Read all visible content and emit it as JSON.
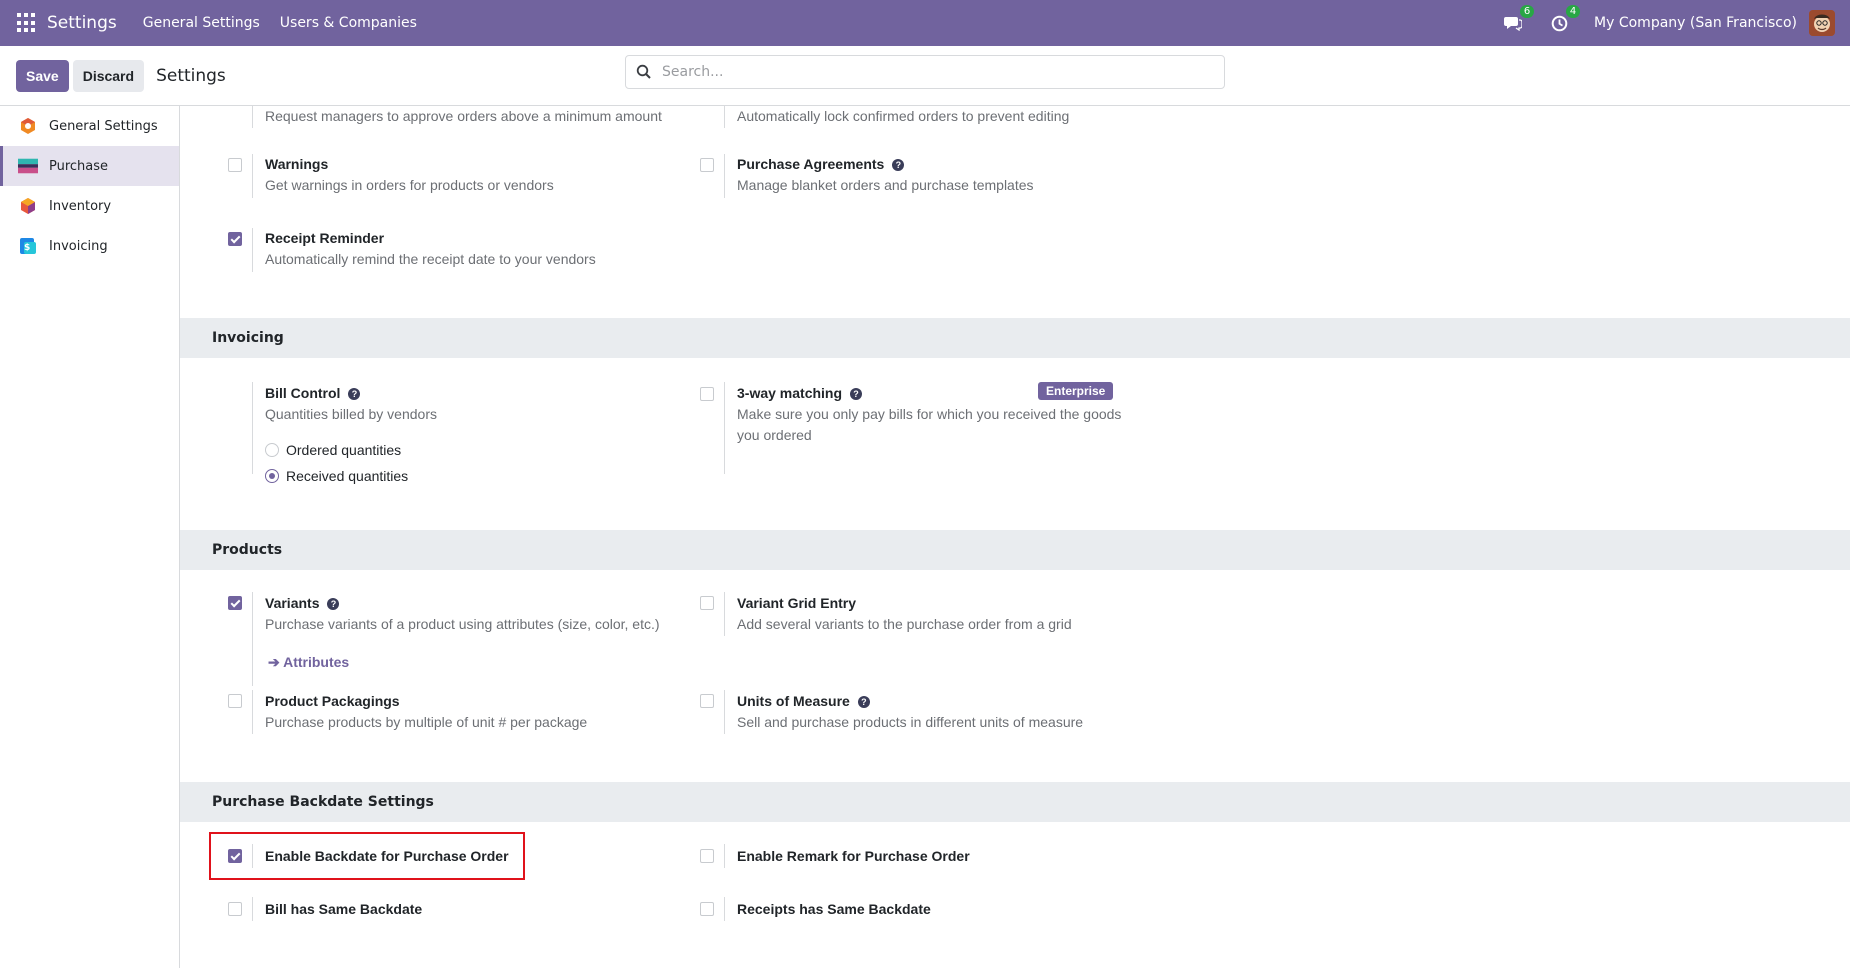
{
  "topbar": {
    "app_title": "Settings",
    "menu_items": [
      "General Settings",
      "Users & Companies"
    ],
    "messages_count": "6",
    "activities_count": "4",
    "company": "My Company (San Francisco)"
  },
  "control": {
    "save_label": "Save",
    "discard_label": "Discard",
    "title": "Settings",
    "search_placeholder": "Search..."
  },
  "sidebar": {
    "items": [
      {
        "label": "General Settings",
        "icon": "general-settings-icon",
        "active": false
      },
      {
        "label": "Purchase",
        "icon": "purchase-icon",
        "active": true
      },
      {
        "label": "Inventory",
        "icon": "inventory-icon",
        "active": false
      },
      {
        "label": "Invoicing",
        "icon": "invoicing-icon",
        "active": false
      }
    ]
  },
  "orders_partial": {
    "left_desc": "Request managers to approve orders above a minimum amount",
    "right_desc": "Automatically lock confirmed orders to prevent editing"
  },
  "orders": {
    "warnings": {
      "title": "Warnings",
      "desc": "Get warnings in orders for products or vendors",
      "checked": false
    },
    "agreements": {
      "title": "Purchase Agreements",
      "desc": "Manage blanket orders and purchase templates",
      "checked": false
    },
    "receipt_reminder": {
      "title": "Receipt Reminder",
      "desc": "Automatically remind the receipt date to your vendors",
      "checked": true
    }
  },
  "invoicing": {
    "heading": "Invoicing",
    "bill_control": {
      "title": "Bill Control",
      "desc": "Quantities billed by vendors",
      "options": [
        "Ordered quantities",
        "Received quantities"
      ],
      "selected": "Received quantities"
    },
    "three_way": {
      "title": "3-way matching",
      "badge": "Enterprise",
      "desc_line1": "Make sure you only pay bills for which you received the goods",
      "desc_line2": "you ordered",
      "checked": false
    }
  },
  "products": {
    "heading": "Products",
    "variants": {
      "title": "Variants",
      "desc": "Purchase variants of a product using attributes (size, color, etc.)",
      "link": "Attributes",
      "checked": true
    },
    "variant_grid": {
      "title": "Variant Grid Entry",
      "desc": "Add several variants to the purchase order from a grid",
      "checked": false
    },
    "packagings": {
      "title": "Product Packagings",
      "desc": "Purchase products by multiple of unit # per package",
      "checked": false
    },
    "uom": {
      "title": "Units of Measure",
      "desc": "Sell and purchase products in different units of measure",
      "checked": false
    }
  },
  "backdate": {
    "heading": "Purchase Backdate Settings",
    "enable_backdate": {
      "title": "Enable Backdate for Purchase Order",
      "checked": true
    },
    "enable_remark": {
      "title": "Enable Remark for Purchase Order",
      "checked": false
    },
    "bill_same": {
      "title": "Bill has Same Backdate",
      "checked": false
    },
    "receipts_same": {
      "title": "Receipts has Same Backdate",
      "checked": false
    }
  },
  "colors": {
    "brand": "#71639e",
    "section_bg": "#e9ecef",
    "highlight": "#e0121b",
    "badge_green": "#28a745"
  }
}
